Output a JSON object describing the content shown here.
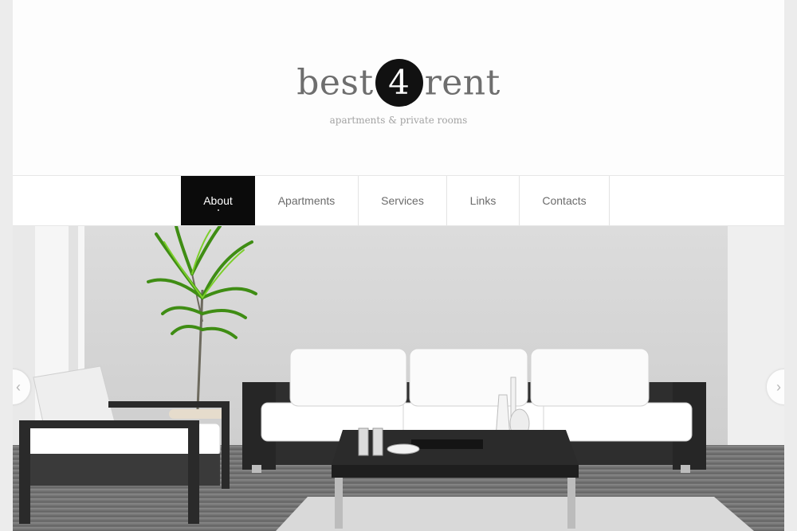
{
  "brand": {
    "prefix": "best",
    "number": "4",
    "suffix": "rent",
    "tagline": "apartments & private rooms"
  },
  "nav": {
    "items": [
      {
        "label": "About",
        "active": true
      },
      {
        "label": "Apartments",
        "active": false
      },
      {
        "label": "Services",
        "active": false
      },
      {
        "label": "Links",
        "active": false
      },
      {
        "label": "Contacts",
        "active": false
      }
    ]
  },
  "slider": {
    "prev_icon": "chevron-left-icon",
    "next_icon": "chevron-right-icon",
    "prev_glyph": "‹",
    "next_glyph": "›"
  },
  "colors": {
    "accent": "#0b0b0b",
    "nav_text": "#6b6b6b",
    "logo_text": "#6e6e6e",
    "plant_green": "#4a9a1a"
  }
}
